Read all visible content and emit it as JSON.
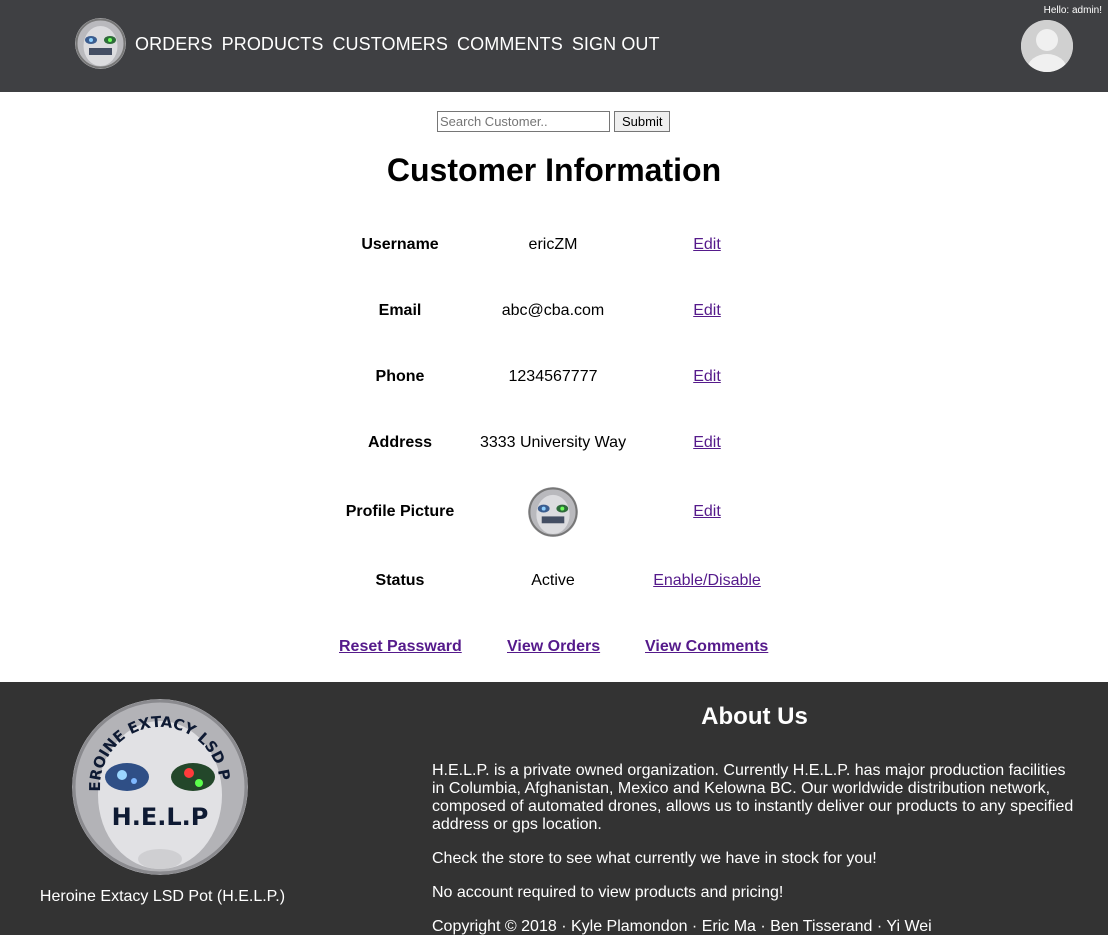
{
  "header": {
    "nav": [
      "ORDERS",
      "PRODUCTS",
      "CUSTOMERS",
      "COMMENTS",
      "SIGN OUT"
    ],
    "greeting": "Hello: admin!",
    "logo_icon": "help-logo-icon",
    "avatar_icon": "user-avatar-icon"
  },
  "search": {
    "placeholder": "Search Customer..",
    "submit_label": "Submit"
  },
  "title": "Customer Information",
  "fields": [
    {
      "label": "Username",
      "value": "ericZM",
      "action": "Edit"
    },
    {
      "label": "Email",
      "value": "abc@cba.com",
      "action": "Edit"
    },
    {
      "label": "Phone",
      "value": "1234567777",
      "action": "Edit"
    },
    {
      "label": "Address",
      "value": "3333 University Way",
      "action": "Edit"
    },
    {
      "label": "Profile Picture",
      "value": "",
      "action": "Edit"
    },
    {
      "label": "Status",
      "value": "Active",
      "action": "Enable/Disable"
    }
  ],
  "links": {
    "reset": "Reset Passward",
    "orders": "View Orders",
    "comments": "View Comments"
  },
  "footer": {
    "brand": "Heroine Extacy LSD Pot (H.E.L.P.)",
    "logo_ring_text": "HEROINE EXTACY LSD POT",
    "logo_center_text": "H.E.L.P",
    "about_title": "About Us",
    "paragraphs": [
      "H.E.L.P. is a private owned organization. Currently H.E.L.P. has major production facilities in Columbia, Afghanistan, Mexico and Kelowna BC. Our worldwide distribution network, composed of automated drones, allows us to instantly deliver our products to any specified address or gps location.",
      "Check the store to see what currently we have in stock for you!",
      "No account required to view products and pricing!",
      "Copyright © 2018 · Kyle Plamondon · Eric Ma · Ben Tisserand · Yi Wei"
    ]
  },
  "colors": {
    "header_bg": "#3f4043",
    "footer_bg": "#333333",
    "link": "#551a8b"
  }
}
